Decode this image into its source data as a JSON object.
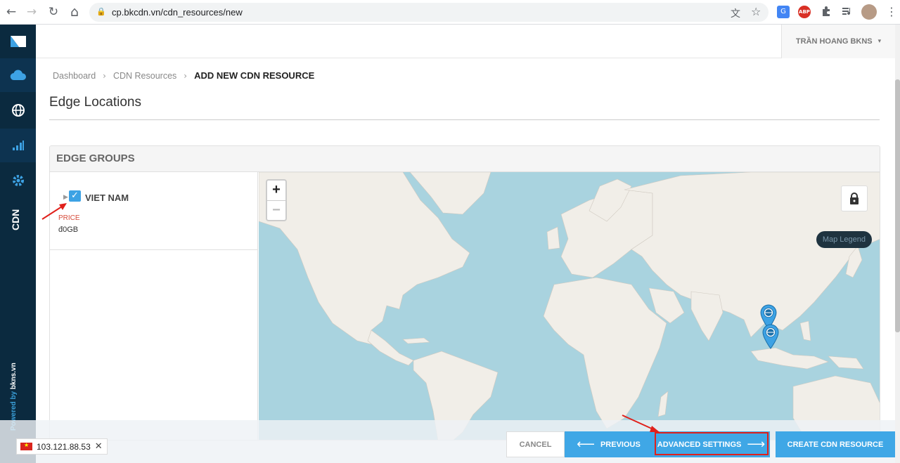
{
  "browser": {
    "url": "cp.bkcdn.vn/cdn_resources/new",
    "back_icon": "←",
    "forward_icon": "→",
    "reload_icon": "↻",
    "home_icon": "⌂",
    "lock_icon": "🔒",
    "translate_icon": "文",
    "star_icon": "☆",
    "menu_icon": "⋮",
    "abp_label": "ABP"
  },
  "user": {
    "name": "TRẦN HOANG BKNS",
    "caret": "▾"
  },
  "sidebar": {
    "vertical_label": "CDN",
    "powered_prefix": "Powered by ",
    "powered_brand": "bkns.vn"
  },
  "breadcrumb": {
    "items": [
      "Dashboard",
      "CDN Resources",
      "ADD NEW CDN RESOURCE"
    ],
    "separator": "›"
  },
  "page": {
    "title": "Edge Locations"
  },
  "panel": {
    "header": "EDGE GROUPS",
    "group": {
      "caret": "▶",
      "check": "✓",
      "name": "VIET NAM",
      "price_label": "PRICE",
      "price_value": "đ0GB"
    }
  },
  "map": {
    "zoom_in": "+",
    "zoom_out": "−",
    "legend": "Map Legend",
    "water_color": "#a9d3df",
    "land_color": "#f1eee8"
  },
  "actions": {
    "cancel": "CANCEL",
    "previous": "PREVIOUS",
    "advanced": "ADVANCED SETTINGS",
    "create": "CREATE CDN RESOURCE",
    "arrow_left": "⟵",
    "arrow_right": "⟶"
  },
  "ip_toast": {
    "ip": "103.121.88.53",
    "close": "✕",
    "flag_star": "★"
  }
}
